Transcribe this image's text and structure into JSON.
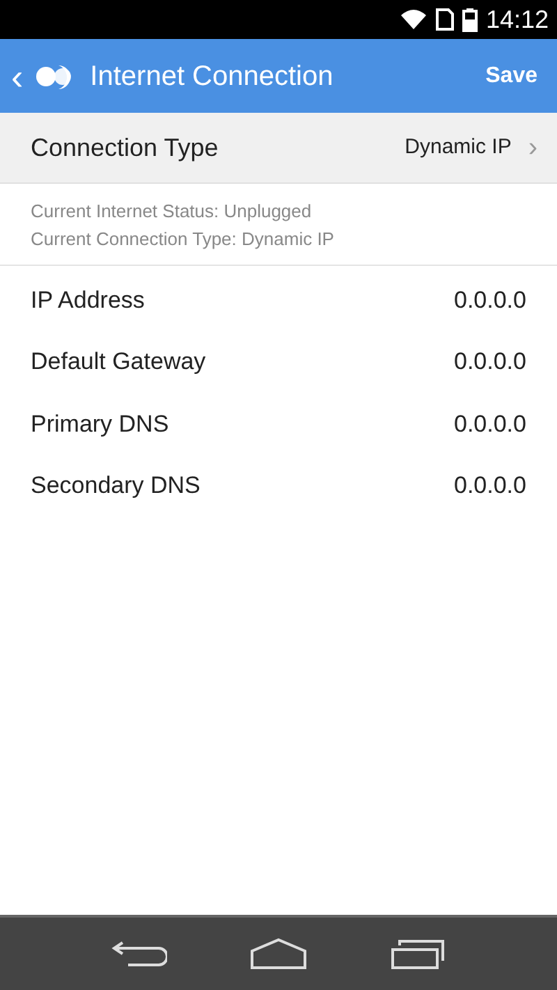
{
  "status_bar": {
    "time": "14:12"
  },
  "app_bar": {
    "back": "‹",
    "title": "Internet Connection",
    "action": "Save"
  },
  "connection_type": {
    "label": "Connection Type",
    "value": "Dynamic IP",
    "chevron": "›"
  },
  "info": [
    "Current Internet Status: Unplugged",
    "Current Connection Type: Dynamic IP"
  ],
  "fields": [
    {
      "label": "IP Address",
      "value": "0.0.0.0"
    },
    {
      "label": "Default Gateway",
      "value": "0.0.0.0"
    },
    {
      "label": "Primary DNS",
      "value": "0.0.0.0"
    },
    {
      "label": "Secondary DNS",
      "value": "0.0.0.0"
    }
  ]
}
